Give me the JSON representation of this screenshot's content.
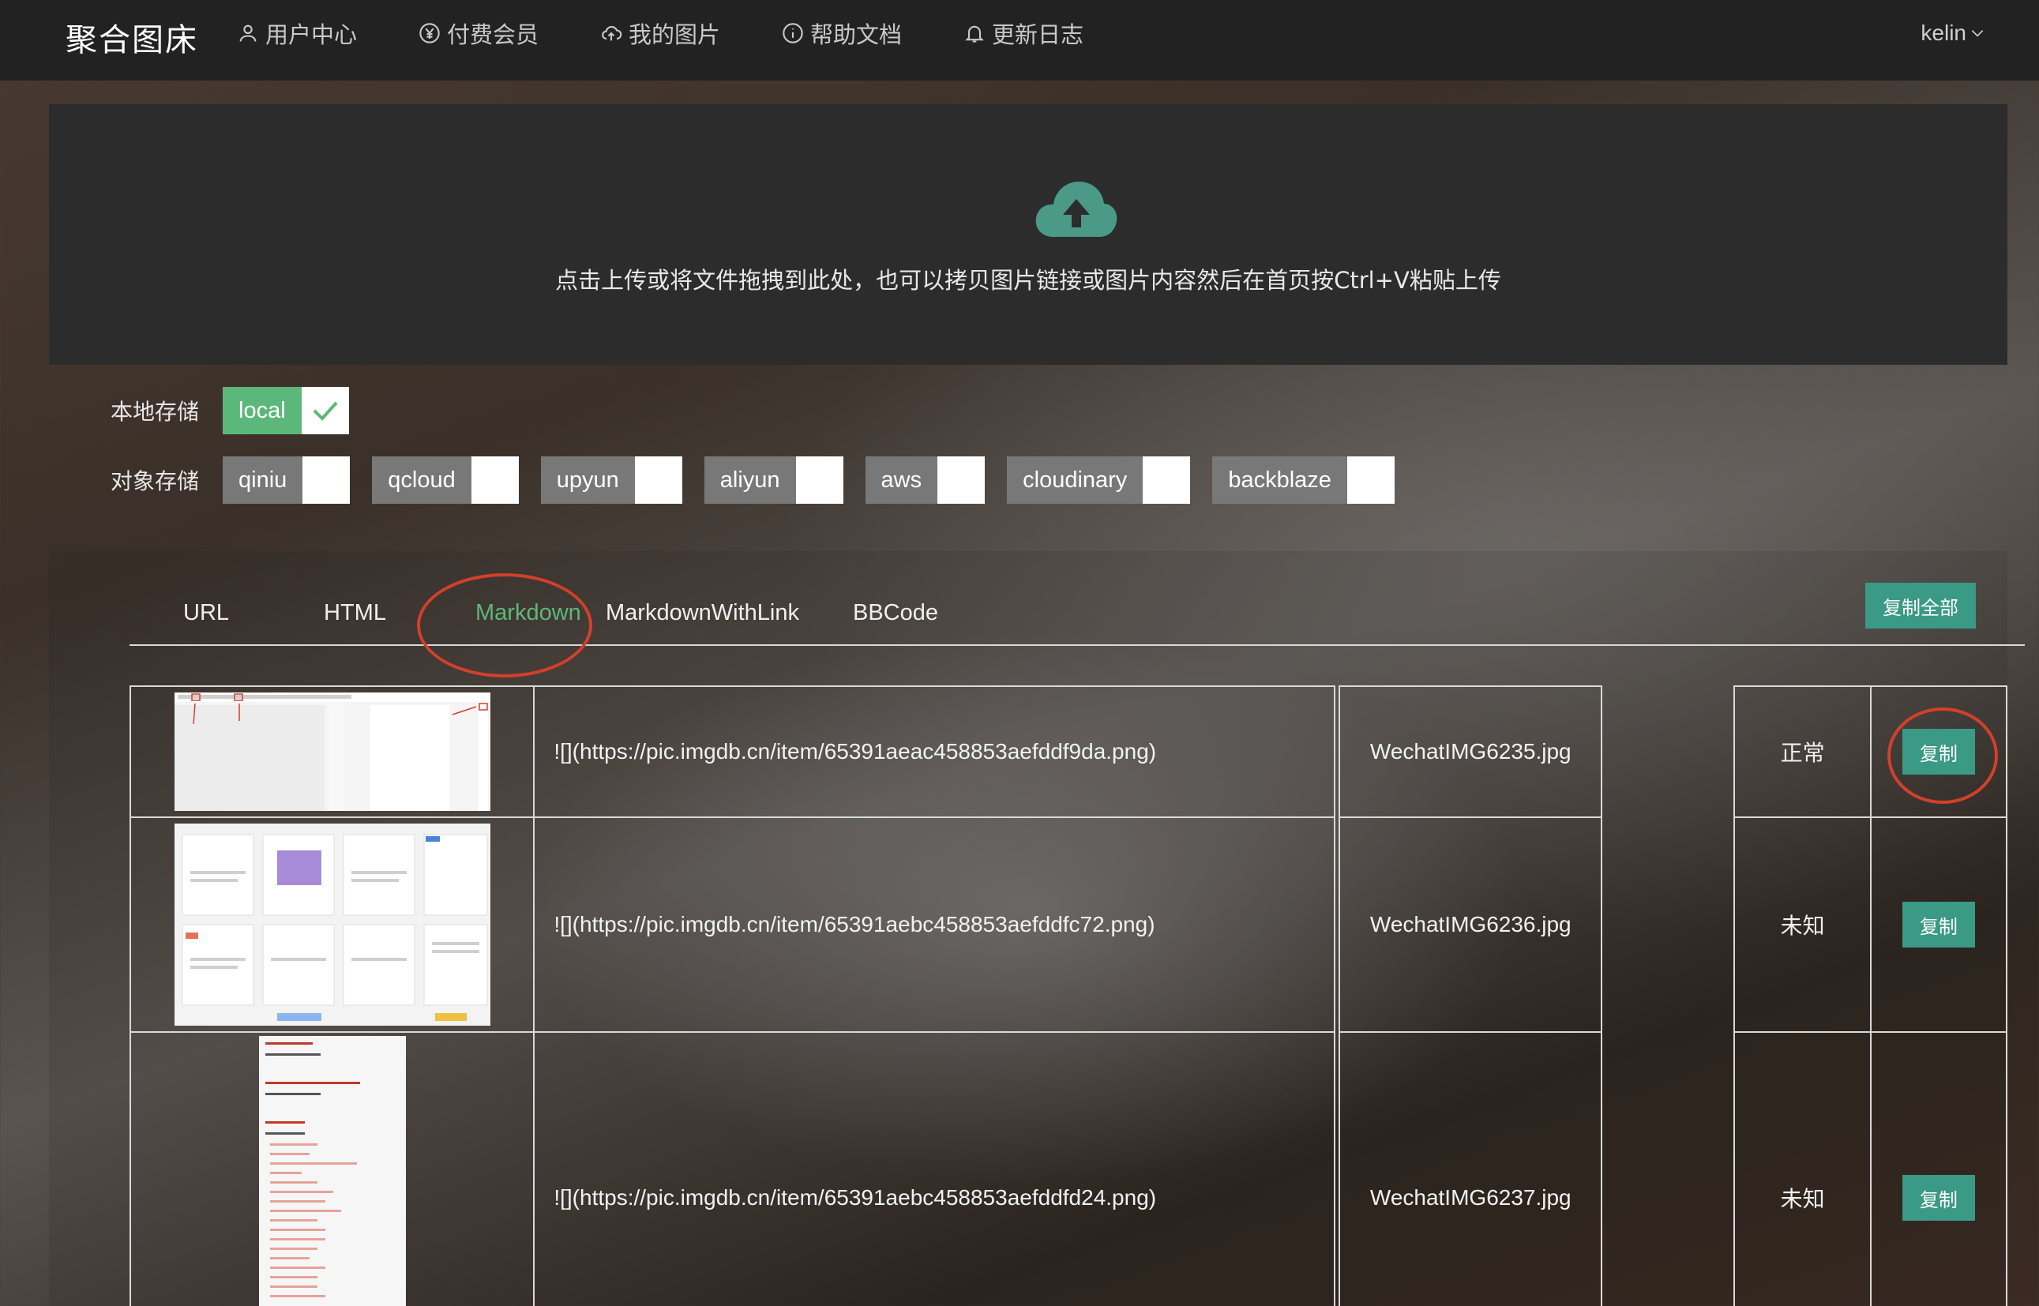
{
  "nav": {
    "brand": "聚合图床",
    "items": [
      {
        "label": "用户中心",
        "icon": "user-icon"
      },
      {
        "label": "付费会员",
        "icon": "yen-icon"
      },
      {
        "label": "我的图片",
        "icon": "cloud-upload-icon"
      },
      {
        "label": "帮助文档",
        "icon": "info-icon"
      },
      {
        "label": "更新日志",
        "icon": "bell-icon"
      }
    ],
    "user": "kelin"
  },
  "upload": {
    "hint": "点击上传或将文件拖拽到此处，也可以拷贝图片链接或图片内容然后在首页按Ctrl+V粘贴上传",
    "accent": "#4a9a87"
  },
  "storage": {
    "local_label": "本地存储",
    "local_options": [
      {
        "name": "local",
        "checked": true
      }
    ],
    "object_label": "对象存储",
    "object_options": [
      {
        "name": "qiniu",
        "checked": false
      },
      {
        "name": "qcloud",
        "checked": false
      },
      {
        "name": "upyun",
        "checked": false
      },
      {
        "name": "aliyun",
        "checked": false
      },
      {
        "name": "aws",
        "checked": false
      },
      {
        "name": "cloudinary",
        "checked": false
      },
      {
        "name": "backblaze",
        "checked": false
      }
    ]
  },
  "result": {
    "tabs": [
      "URL",
      "HTML",
      "Markdown",
      "MarkdownWithLink",
      "BBCode"
    ],
    "active_tab": "Markdown",
    "copy_all": "复制全部",
    "rows": [
      {
        "code": "![](https://pic.imgdb.cn/item/65391aeac458853aefddf9da.png)",
        "filename": "WechatIMG6235.jpg",
        "status": "正常",
        "copy": "复制"
      },
      {
        "code": "![](https://pic.imgdb.cn/item/65391aebc458853aefddfc72.png)",
        "filename": "WechatIMG6236.jpg",
        "status": "未知",
        "copy": "复制"
      },
      {
        "code": "![](https://pic.imgdb.cn/item/65391aebc458853aefddfd24.png)",
        "filename": "WechatIMG6237.jpg",
        "status": "未知",
        "copy": "复制"
      }
    ]
  },
  "colors": {
    "accent_green": "#5cb87a",
    "button_teal": "#3a9a86",
    "annotation_red": "#d2402b",
    "nav_bg": "#222222"
  }
}
